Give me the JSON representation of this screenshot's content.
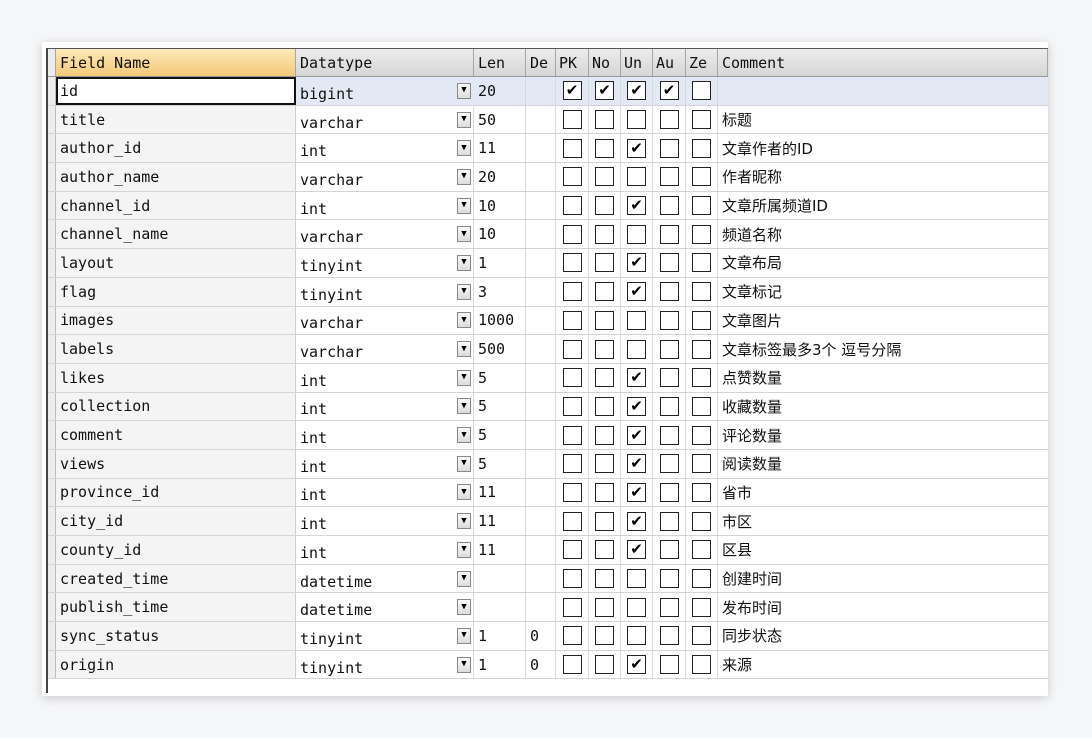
{
  "headers": {
    "name": "Field Name",
    "type": "Datatype",
    "len": "Len",
    "de": "De",
    "pk": "PK",
    "no": "No",
    "un": "Un",
    "au": "Au",
    "ze": "Ze",
    "comment": "Comment"
  },
  "dropdown_glyph": "▼",
  "check_glyph": "✔",
  "rows": [
    {
      "name": "id",
      "type": "bigint",
      "len": "20",
      "de": "",
      "pk": true,
      "no": true,
      "un": true,
      "au": true,
      "ze": false,
      "comment": ""
    },
    {
      "name": "title",
      "type": "varchar",
      "len": "50",
      "de": "",
      "pk": false,
      "no": false,
      "un": false,
      "au": false,
      "ze": false,
      "comment": "标题"
    },
    {
      "name": "author_id",
      "type": "int",
      "len": "11",
      "de": "",
      "pk": false,
      "no": false,
      "un": true,
      "au": false,
      "ze": false,
      "comment": "文章作者的ID"
    },
    {
      "name": "author_name",
      "type": "varchar",
      "len": "20",
      "de": "",
      "pk": false,
      "no": false,
      "un": false,
      "au": false,
      "ze": false,
      "comment": "作者昵称"
    },
    {
      "name": "channel_id",
      "type": "int",
      "len": "10",
      "de": "",
      "pk": false,
      "no": false,
      "un": true,
      "au": false,
      "ze": false,
      "comment": "文章所属频道ID"
    },
    {
      "name": "channel_name",
      "type": "varchar",
      "len": "10",
      "de": "",
      "pk": false,
      "no": false,
      "un": false,
      "au": false,
      "ze": false,
      "comment": "频道名称"
    },
    {
      "name": "layout",
      "type": "tinyint",
      "len": "1",
      "de": "",
      "pk": false,
      "no": false,
      "un": true,
      "au": false,
      "ze": false,
      "comment": "文章布局"
    },
    {
      "name": "flag",
      "type": "tinyint",
      "len": "3",
      "de": "",
      "pk": false,
      "no": false,
      "un": true,
      "au": false,
      "ze": false,
      "comment": "文章标记"
    },
    {
      "name": "images",
      "type": "varchar",
      "len": "1000",
      "de": "",
      "pk": false,
      "no": false,
      "un": false,
      "au": false,
      "ze": false,
      "comment": "文章图片"
    },
    {
      "name": "labels",
      "type": "varchar",
      "len": "500",
      "de": "",
      "pk": false,
      "no": false,
      "un": false,
      "au": false,
      "ze": false,
      "comment": "文章标签最多3个 逗号分隔"
    },
    {
      "name": "likes",
      "type": "int",
      "len": "5",
      "de": "",
      "pk": false,
      "no": false,
      "un": true,
      "au": false,
      "ze": false,
      "comment": "点赞数量"
    },
    {
      "name": "collection",
      "type": "int",
      "len": "5",
      "de": "",
      "pk": false,
      "no": false,
      "un": true,
      "au": false,
      "ze": false,
      "comment": "收藏数量"
    },
    {
      "name": "comment",
      "type": "int",
      "len": "5",
      "de": "",
      "pk": false,
      "no": false,
      "un": true,
      "au": false,
      "ze": false,
      "comment": "评论数量"
    },
    {
      "name": "views",
      "type": "int",
      "len": "5",
      "de": "",
      "pk": false,
      "no": false,
      "un": true,
      "au": false,
      "ze": false,
      "comment": "阅读数量"
    },
    {
      "name": "province_id",
      "type": "int",
      "len": "11",
      "de": "",
      "pk": false,
      "no": false,
      "un": true,
      "au": false,
      "ze": false,
      "comment": "省市"
    },
    {
      "name": "city_id",
      "type": "int",
      "len": "11",
      "de": "",
      "pk": false,
      "no": false,
      "un": true,
      "au": false,
      "ze": false,
      "comment": "市区"
    },
    {
      "name": "county_id",
      "type": "int",
      "len": "11",
      "de": "",
      "pk": false,
      "no": false,
      "un": true,
      "au": false,
      "ze": false,
      "comment": "区县"
    },
    {
      "name": "created_time",
      "type": "datetime",
      "len": "",
      "de": "",
      "pk": false,
      "no": false,
      "un": false,
      "au": false,
      "ze": false,
      "comment": "创建时间"
    },
    {
      "name": "publish_time",
      "type": "datetime",
      "len": "",
      "de": "",
      "pk": false,
      "no": false,
      "un": false,
      "au": false,
      "ze": false,
      "comment": "发布时间"
    },
    {
      "name": "sync_status",
      "type": "tinyint",
      "len": "1",
      "de": "0",
      "pk": false,
      "no": false,
      "un": false,
      "au": false,
      "ze": false,
      "comment": "同步状态"
    },
    {
      "name": "origin",
      "type": "tinyint",
      "len": "1",
      "de": "0",
      "pk": false,
      "no": false,
      "un": true,
      "au": false,
      "ze": false,
      "comment": "来源"
    }
  ]
}
